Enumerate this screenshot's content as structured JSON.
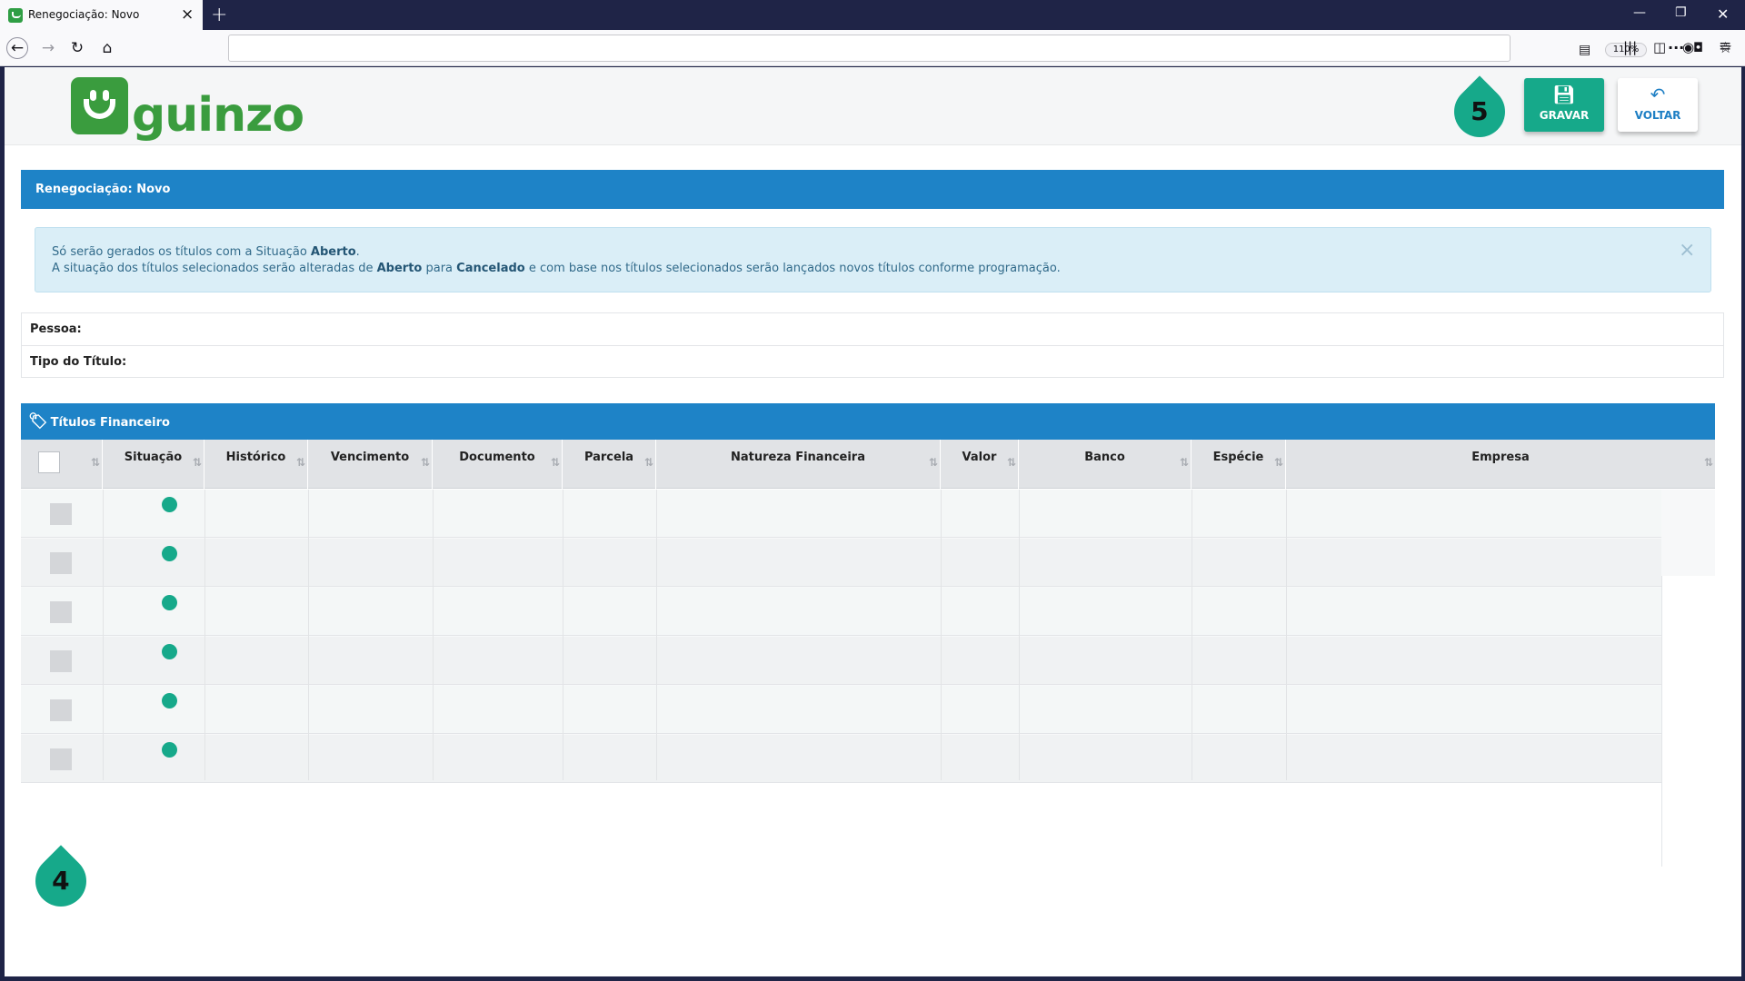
{
  "browser": {
    "tab_title": "Renegociação: Novo",
    "zoom": "110%"
  },
  "logo": {
    "text": "guinzo"
  },
  "actions": {
    "step_badge_top": "5",
    "save_label": "GRAVAR",
    "back_label": "VOLTAR"
  },
  "page": {
    "title": "Renegociação: Novo"
  },
  "alert": {
    "line1_prefix": "Só serão gerados os títulos com a Situação ",
    "line1_status": "Aberto",
    "line1_suffix": ".",
    "line2_prefix": "A situação dos títulos selecionados serão alteradas de ",
    "line2_from": "Aberto",
    "line2_mid": " para ",
    "line2_to": "Cancelado",
    "line2_suffix": " e com base nos títulos selecionados serão lançados novos títulos conforme programação.",
    "close": "×"
  },
  "form": {
    "pessoa_label": "Pessoa:",
    "tipo_label": "Tipo do Título:"
  },
  "section": {
    "title": "Títulos Financeiro",
    "columns": [
      "Situação",
      "Histórico",
      "Vencimento",
      "Documento",
      "Parcela",
      "Natureza Financeira",
      "Valor",
      "Banco",
      "Espécie",
      "Empresa"
    ],
    "rows": 6,
    "status_color": "#16a98a"
  },
  "step_badge_bottom": "4",
  "colors": {
    "brand_green": "#3a9c3e",
    "accent_teal": "#16a98a",
    "header_blue": "#1e83c7"
  }
}
